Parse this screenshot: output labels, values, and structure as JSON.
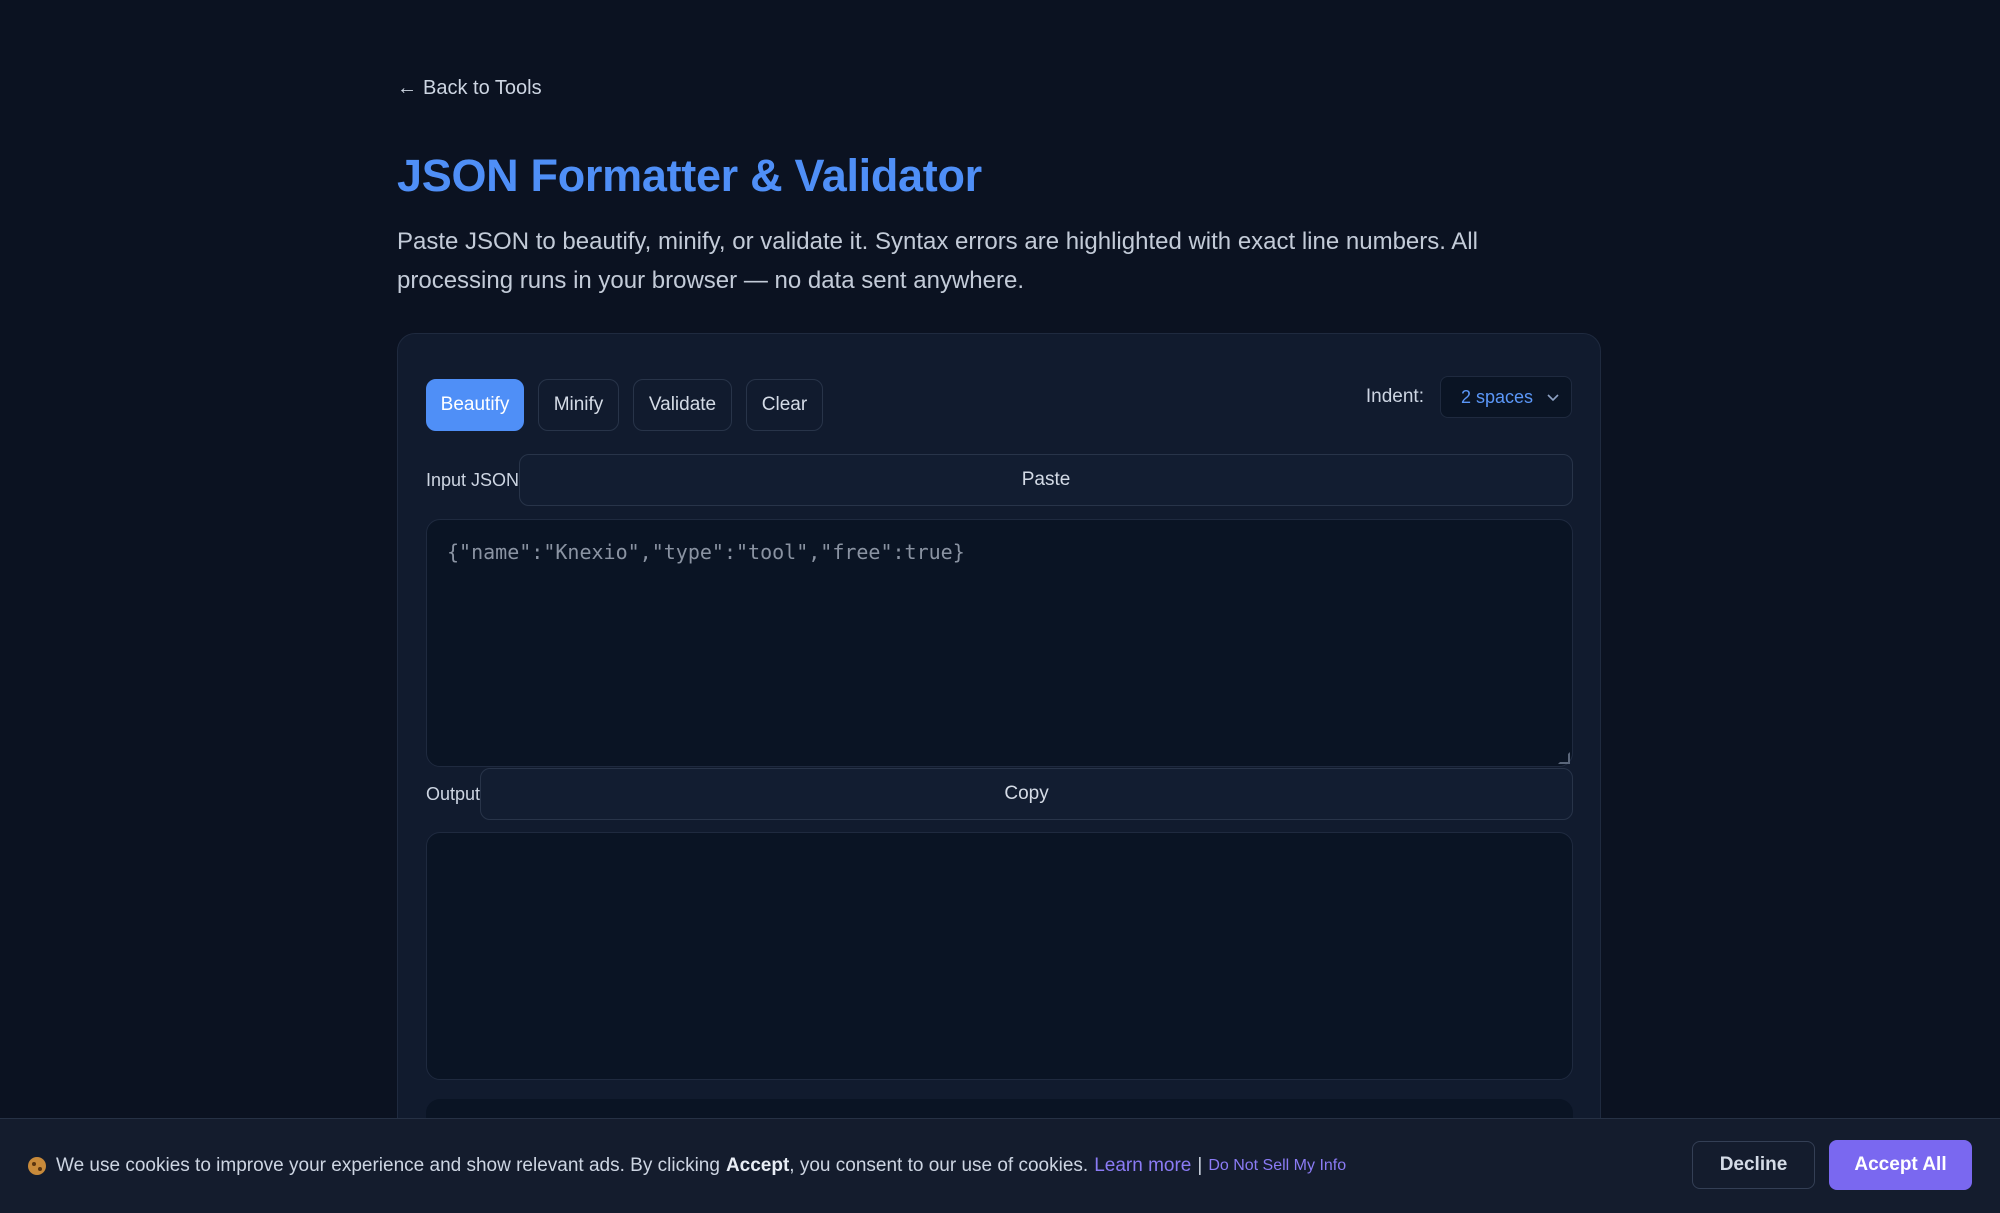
{
  "nav": {
    "back_arrow": "←",
    "back_label": "Back to Tools"
  },
  "header": {
    "title": "JSON Formatter & Validator",
    "description": "Paste JSON to beautify, minify, or validate it. Syntax errors are highlighted with exact line numbers. All processing runs in your browser — no data sent anywhere."
  },
  "toolbar": {
    "beautify_label": "Beautify",
    "minify_label": "Minify",
    "validate_label": "Validate",
    "clear_label": "Clear",
    "indent_label": "Indent:",
    "indent_value": "2 spaces"
  },
  "input": {
    "label": "Input JSON",
    "paste_label": "Paste",
    "placeholder": "{\"name\":\"Knexio\",\"type\":\"tool\",\"free\":true}"
  },
  "output": {
    "label": "Output",
    "copy_label": "Copy",
    "value": ""
  },
  "cookie": {
    "text_before": "We use cookies to improve your experience and show relevant ads. By clicking",
    "accept_word": "Accept",
    "text_after": ", you consent to our use of cookies.",
    "learn_more": "Learn more",
    "separator": "|",
    "do_not_sell": "Do Not Sell My Info",
    "decline_label": "Decline",
    "accept_all_label": "Accept All"
  },
  "colors": {
    "background": "#0b1221",
    "accent": "#4f8ff7",
    "cookie_accent": "#7a68f0"
  }
}
